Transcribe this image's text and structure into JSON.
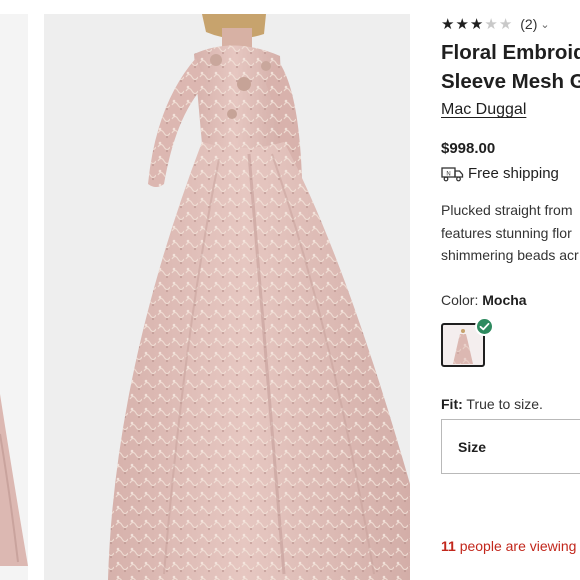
{
  "product": {
    "rating": {
      "value": 3,
      "max": 5,
      "review_count": "(2)"
    },
    "title_lines": [
      "Floral Embroid",
      "Sleeve Mesh G"
    ],
    "brand": "Mac Duggal",
    "price": "$998.00",
    "shipping": {
      "icon": "truck-icon",
      "label": "Free shipping"
    },
    "description_lines": [
      "Plucked straight from",
      "features stunning flor",
      "shimmering beads acr"
    ],
    "color": {
      "label": "Color:",
      "value": "Mocha",
      "swatch_selected": true
    },
    "fit": {
      "label": "Fit:",
      "value": "True to size."
    },
    "size_select": {
      "label": "Size"
    },
    "viewing": {
      "count": "11",
      "text": " people are viewing"
    }
  },
  "colors": {
    "gown": "#e3c2bd",
    "gown_shadow": "#caa49f",
    "lace": "#f3e3d9",
    "check_green": "#2e8a5f",
    "alert_red": "#c2271c",
    "photo_bg": "#eeeeee"
  }
}
